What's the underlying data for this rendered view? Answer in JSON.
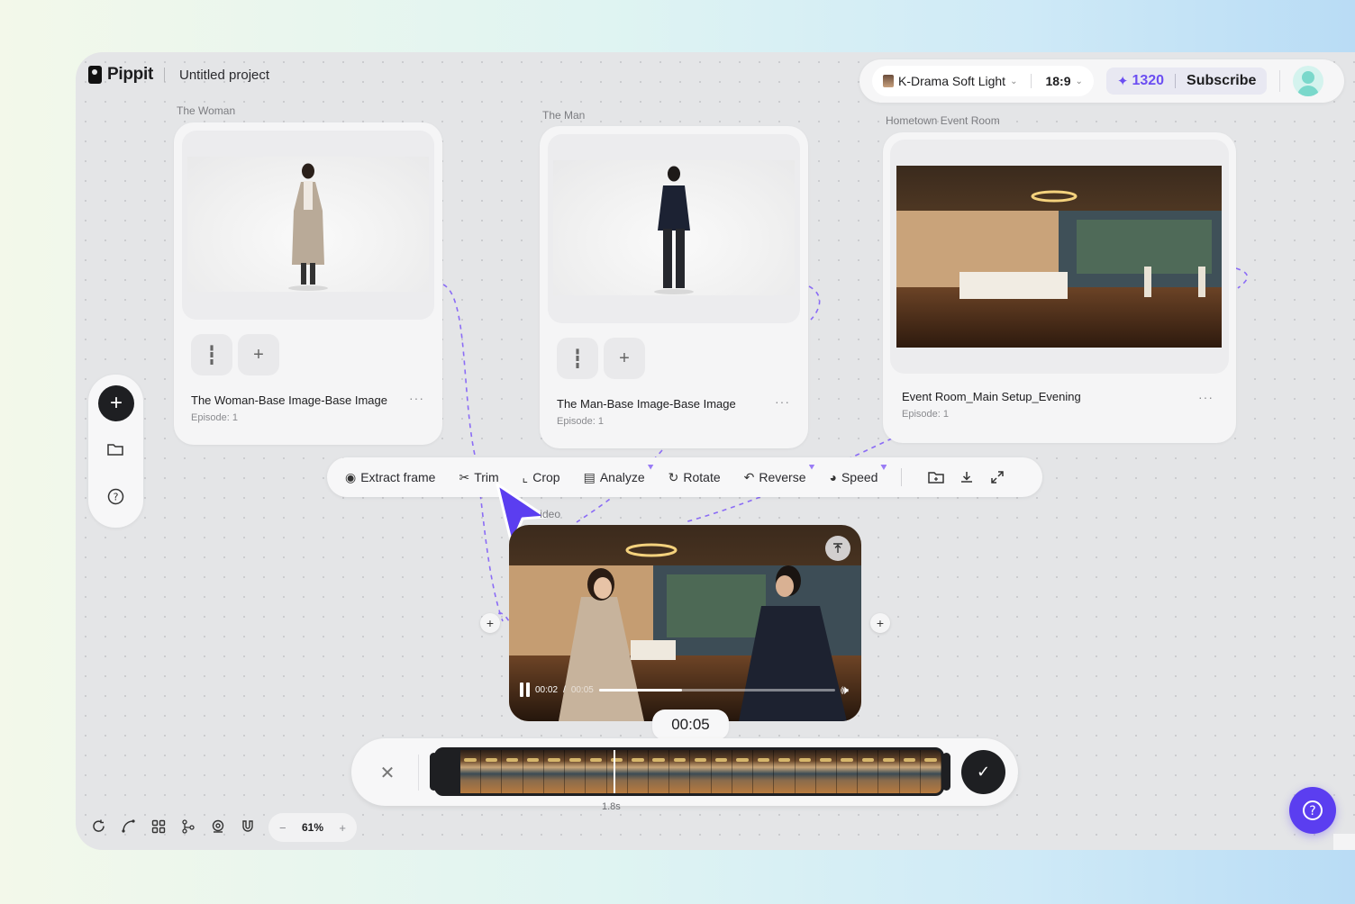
{
  "app": {
    "brand": "Pippit",
    "project_title": "Untitled project"
  },
  "topbar": {
    "style_name": "K-Drama Soft Light",
    "aspect_ratio": "18:9",
    "credits": "1320",
    "subscribe_label": "Subscribe"
  },
  "nodes": [
    {
      "label": "The Woman",
      "title": "The Woman-Base Image-Base Image",
      "episode": "Episode: 1"
    },
    {
      "label": "The Man",
      "title": "The Man-Base Image-Base Image",
      "episode": "Episode: 1"
    },
    {
      "label": "Hometown Event Room",
      "title": "Event Room_Main Setup_Evening",
      "episode": "Episode: 1"
    }
  ],
  "video_node": {
    "label": "Video",
    "current_time": "00:02",
    "total_time": "00:05",
    "progress": 0.35
  },
  "toolbar": {
    "items": [
      {
        "label": "Extract frame",
        "icon": "camera-icon",
        "premium": false
      },
      {
        "label": "Trim",
        "icon": "trim-icon",
        "premium": false
      },
      {
        "label": "Crop",
        "icon": "crop-icon",
        "premium": false
      },
      {
        "label": "Analyze",
        "icon": "analyze-icon",
        "premium": true
      },
      {
        "label": "Rotate",
        "icon": "rotate-icon",
        "premium": false
      },
      {
        "label": "Reverse",
        "icon": "reverse-icon",
        "premium": true
      },
      {
        "label": "Speed",
        "icon": "speed-icon",
        "premium": true
      }
    ]
  },
  "trim": {
    "duration_bubble": "00:05",
    "playhead_label": "1.8s"
  },
  "zoom": {
    "value": "61%",
    "minus": "−",
    "plus": "+"
  },
  "colors": {
    "accent": "#5b3ef0",
    "credit": "#6b4ef2",
    "connector": "#8b6cf6",
    "dark": "#1e1f22"
  }
}
